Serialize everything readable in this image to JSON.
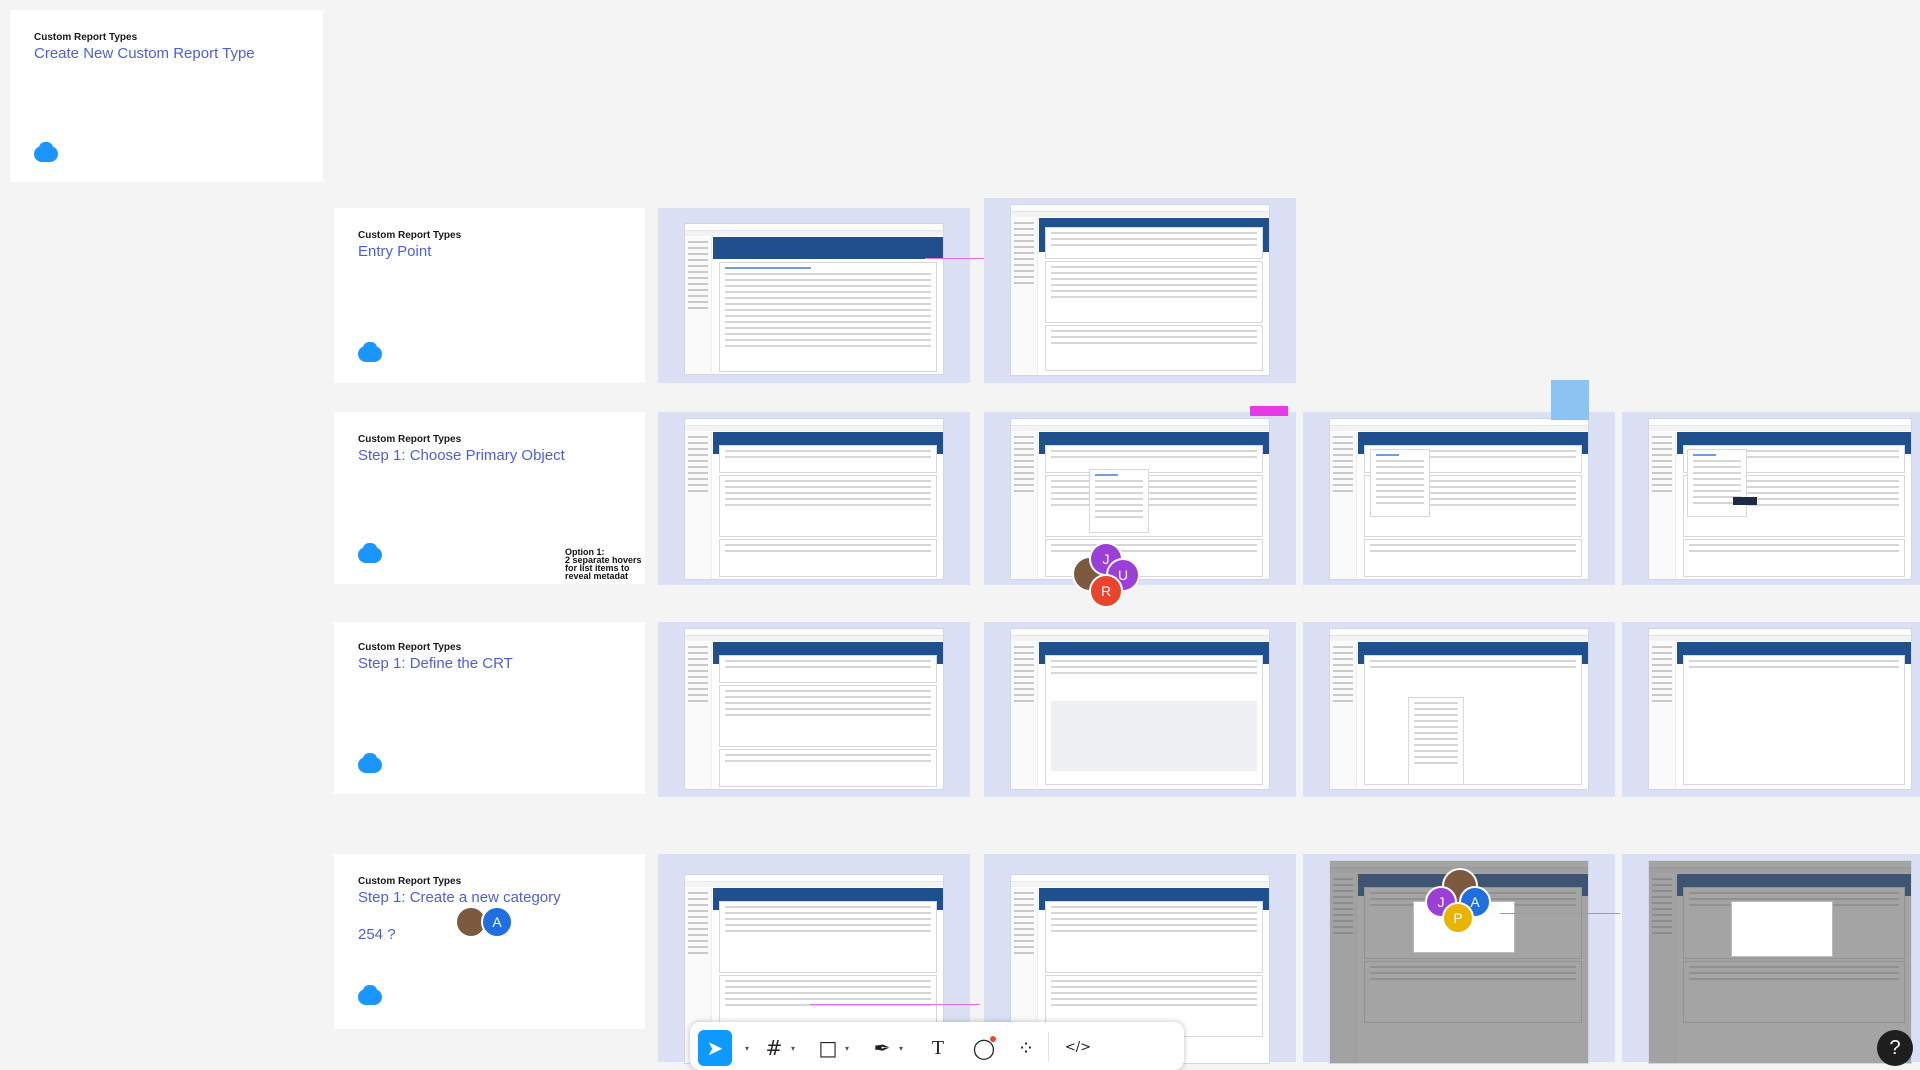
{
  "title_cards": [
    {
      "kicker": "Custom Report Types",
      "heading": "Create New Custom Report Type"
    },
    {
      "kicker": "Custom Report Types",
      "heading": "Entry Point"
    },
    {
      "kicker": "Custom Report Types",
      "heading": "Step 1: Choose Primary Object"
    },
    {
      "kicker": "Custom Report Types",
      "heading": "Step 1: Define the CRT"
    },
    {
      "kicker": "Custom Report Types",
      "heading": "Step 1: Create a new category",
      "extra": "254 ?"
    }
  ],
  "notes": {
    "option": [
      "Option 1:",
      "2 separate hovers",
      "for list items to",
      "reveal metadat"
    ]
  },
  "avatars": [
    {
      "initial": "J",
      "color": "#9b3fd6"
    },
    {
      "initial": "U",
      "color": "#9b3fd6"
    },
    {
      "initial": "R",
      "color": "#e8452c"
    },
    {
      "initial": "A",
      "color": "#1f6fe0"
    },
    {
      "initial": "J",
      "color": "#9b3fd6"
    },
    {
      "initial": "A",
      "color": "#1f6fe0"
    },
    {
      "initial": "P",
      "color": "#e8b400"
    }
  ],
  "toolbar": {
    "tools": [
      "move-tool",
      "frame-tool",
      "shape-tool",
      "pen-tool",
      "text-tool",
      "comment-tool",
      "actions-tool",
      "dev-mode-tool"
    ],
    "text_glyph": "T",
    "dev_glyph": "</>"
  },
  "help": {
    "label": "?"
  },
  "colors": {
    "heading": "#4d5fd6",
    "frame": "#dbe0f5",
    "salesforce_blue": "#1b96ff",
    "header_band": "#1f4f8c"
  }
}
